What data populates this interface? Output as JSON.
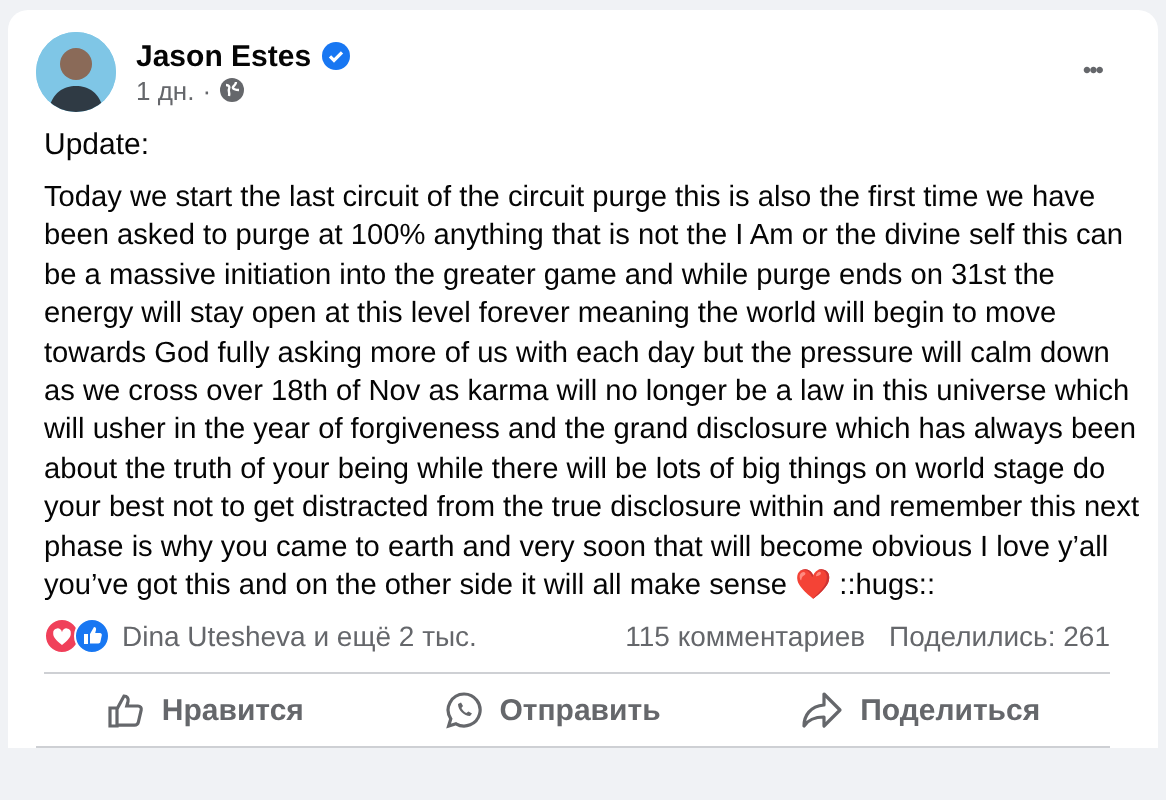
{
  "post": {
    "author": "Jason Estes",
    "verified": true,
    "time": "1 дн.",
    "separator": "·",
    "menu": "•••",
    "title": "Update:",
    "body": "Today we start the last circuit of the circuit purge this is also the first time we have been asked to purge at 100% anything that is not the I Am or the divine self this can be a massive initiation into the greater game and while purge ends on 31st the energy will stay open at this level forever meaning the world will begin to move towards God fully asking more of us with each day but the pressure will calm down as we cross over 18th of Nov as karma will no longer be a law in this universe which will usher in the year of forgiveness and the grand disclosure which has always been about the truth of your being while there will be lots of big things on world stage do your best not to get distracted from the true disclosure within and remember this next phase is why you came to earth and very soon that will become obvious I love y’all you’ve got this and on the other side it will all make sense ❤️ ::hugs::"
  },
  "stats": {
    "reactions": [
      {
        "kind": "love"
      },
      {
        "kind": "like"
      }
    ],
    "reactors": "Dina Utesheva и ещё 2 тыс.",
    "comments": "115 комментариев",
    "shares": "Поделились: 261"
  },
  "actions": [
    {
      "kind": "like",
      "label": "Нравится"
    },
    {
      "kind": "send",
      "label": "Отправить"
    },
    {
      "kind": "share",
      "label": "Поделиться"
    }
  ]
}
